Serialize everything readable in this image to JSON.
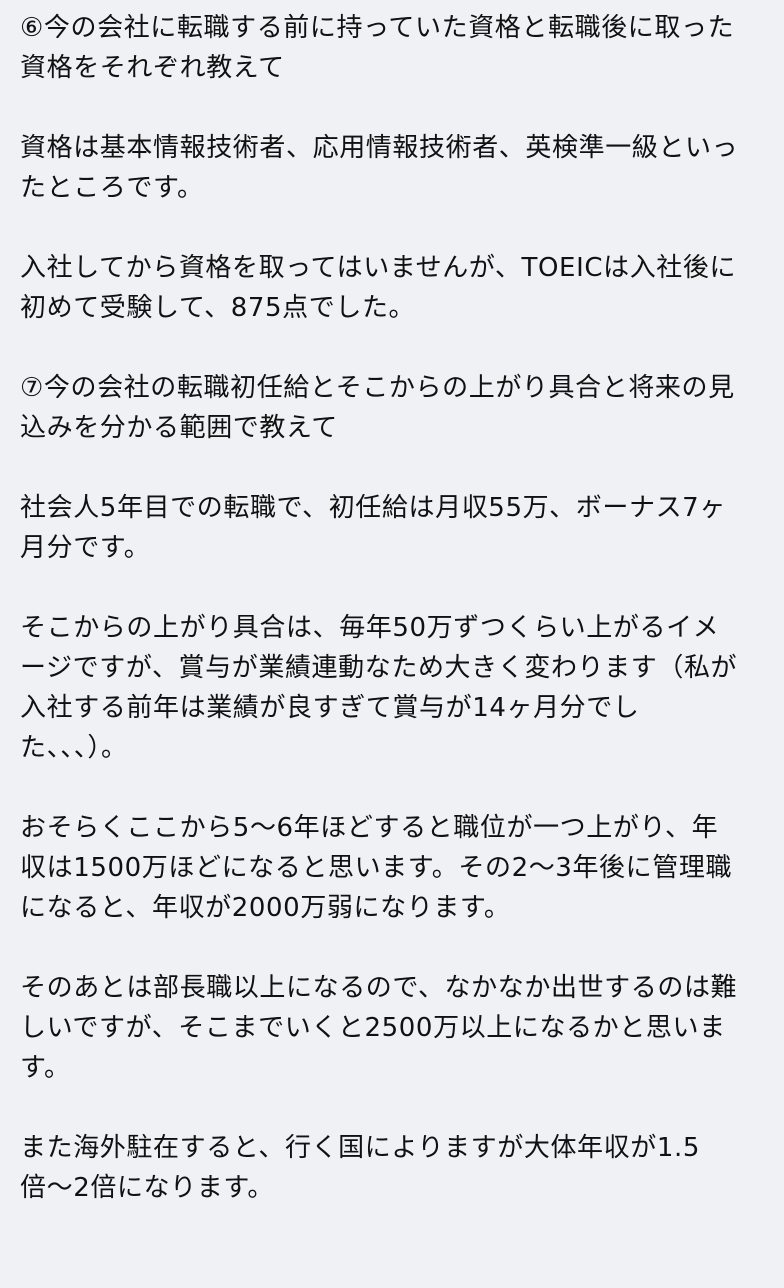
{
  "article": {
    "lines": [
      "⑥今の会社に転職する前に持っていた資格と転職後に取った",
      "資格をそれぞれ教えて",
      "",
      "資格は基本情報技術者、応用情報技術者、英検準一級といっ",
      "たところです。",
      "",
      "入社してから資格を取ってはいませんが、TOEICは入社後に",
      "初めて受験して、875点でした。",
      "",
      "⑦今の会社の転職初任給とそこからの上がり具合と将来の見",
      "込みを分かる範囲で教えて",
      "",
      "社会人5年目での転職で、初任給は月収55万、ボーナス7ヶ",
      "月分です。",
      "",
      "そこからの上がり具合は、毎年50万ずつくらい上がるイメ",
      "ージですが、賞与が業績連動なため大きく変わります（私が",
      "入社する前年は業績が良すぎて賞与が14ヶ月分でし",
      "た、、、）。",
      "",
      "おそらくここから5〜6年ほどすると職位が一つ上がり、年",
      "収は1500万ほどになると思います。その2〜3年後に管理職",
      "になると、年収が2000万弱になります。",
      "",
      "そのあとは部長職以上になるので、なかなか出世するのは難",
      "しいですが、そこまでいくと2500万以上になるかと思いま",
      "す。",
      "",
      "また海外駐在すると、行く国によりますが大体年収が1.5",
      "倍〜2倍になります。"
    ]
  }
}
